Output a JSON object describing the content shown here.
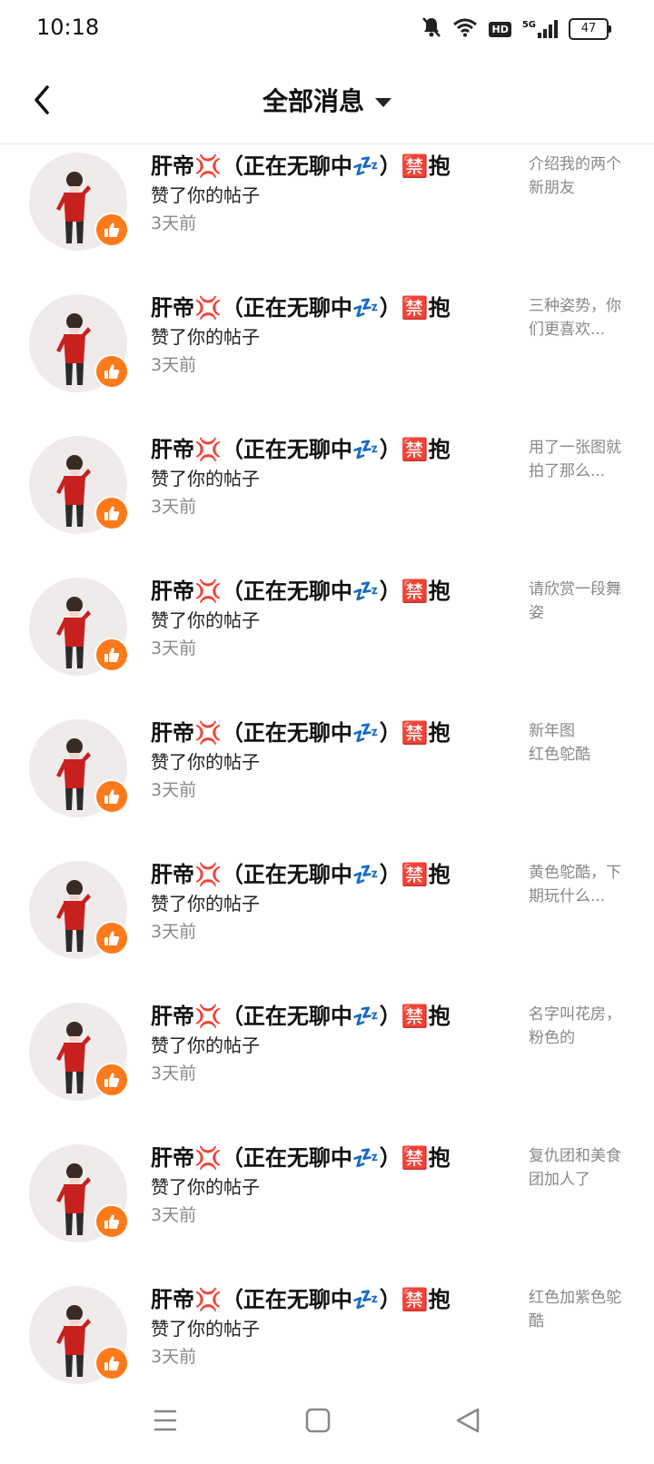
{
  "status_bar": {
    "time": "10:18",
    "network": "5G",
    "hd_label": "HD",
    "battery": "47",
    "icons": [
      "mute-bell-icon",
      "wifi-icon",
      "hd-icon",
      "signal-5g-icon",
      "battery-icon"
    ]
  },
  "header": {
    "title": "全部消息",
    "back_icon": "chevron-left-icon",
    "dropdown_icon": "caret-down-icon"
  },
  "colors": {
    "accent": "#ff7a1a",
    "secondary_text": "#888888",
    "divider": "#e6e6e6",
    "avatar_bg": "#efebeb"
  },
  "messages": [
    {
      "name": "肝帝💢（正在无聊中💤）🈲抱",
      "action": "赞了你的帖子",
      "time": "3天前",
      "preview": "介绍我的两个新朋友"
    },
    {
      "name": "肝帝💢（正在无聊中💤）🈲抱",
      "action": "赞了你的帖子",
      "time": "3天前",
      "preview": "三种姿势，你们更喜欢..."
    },
    {
      "name": "肝帝💢（正在无聊中💤）🈲抱",
      "action": "赞了你的帖子",
      "time": "3天前",
      "preview": "用了一张图就拍了那么..."
    },
    {
      "name": "肝帝💢（正在无聊中💤）🈲抱",
      "action": "赞了你的帖子",
      "time": "3天前",
      "preview": "请欣赏一段舞姿"
    },
    {
      "name": "肝帝💢（正在无聊中💤）🈲抱",
      "action": "赞了你的帖子",
      "time": "3天前",
      "preview": "新年图\n红色鸵酷"
    },
    {
      "name": "肝帝💢（正在无聊中💤）🈲抱",
      "action": "赞了你的帖子",
      "time": "3天前",
      "preview": "黄色鸵酷，下期玩什么..."
    },
    {
      "name": "肝帝💢（正在无聊中💤）🈲抱",
      "action": "赞了你的帖子",
      "time": "3天前",
      "preview": "名字叫花房，粉色的"
    },
    {
      "name": "肝帝💢（正在无聊中💤）🈲抱",
      "action": "赞了你的帖子",
      "time": "3天前",
      "preview": "复仇团和美食团加人了"
    },
    {
      "name": "肝帝💢（正在无聊中💤）🈲抱",
      "action": "赞了你的帖子",
      "time": "3天前",
      "preview": "红色加紫色鸵酷"
    }
  ],
  "nav_bar": {
    "icons": [
      "menu-icon",
      "home-icon",
      "back-icon"
    ]
  }
}
